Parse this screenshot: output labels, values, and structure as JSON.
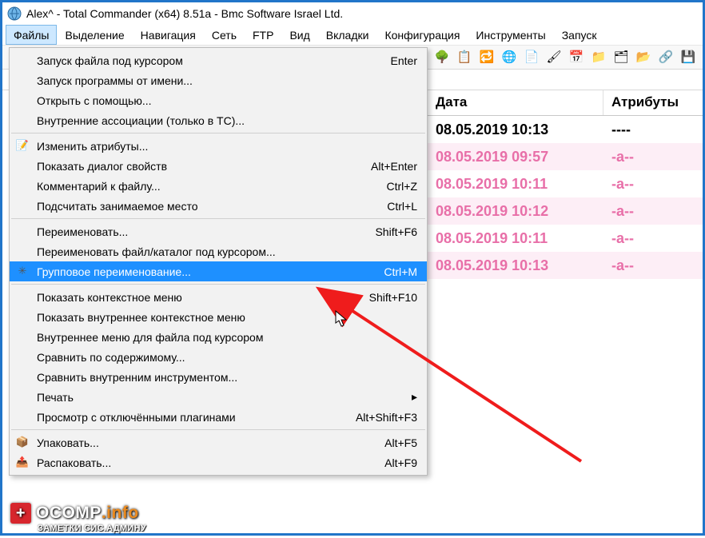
{
  "window": {
    "title": "Alex^ - Total Commander (x64) 8.51a - Bmc Software Israel Ltd."
  },
  "menubar": {
    "items": [
      "Файлы",
      "Выделение",
      "Навигация",
      "Сеть",
      "FTP",
      "Вид",
      "Вкладки",
      "Конфигурация",
      "Инструменты",
      "Запуск"
    ],
    "open_index": 0
  },
  "toolbar_icons": [
    {
      "name": "view-icon",
      "glyph": "🔍"
    },
    {
      "name": "tree-icon",
      "glyph": "🌳"
    },
    {
      "name": "copy-icon",
      "glyph": "📋"
    },
    {
      "name": "sync-icon",
      "glyph": "🔁"
    },
    {
      "name": "ftp-icon",
      "glyph": "🌐"
    },
    {
      "name": "notepad-icon",
      "glyph": "📄"
    },
    {
      "name": "brush-icon",
      "glyph": "🖌"
    },
    {
      "name": "calendar-icon",
      "glyph": "📅"
    },
    {
      "name": "folder-icon",
      "glyph": "📁"
    },
    {
      "name": "folder2-icon",
      "glyph": "🗂"
    },
    {
      "name": "folder3-icon",
      "glyph": "📂"
    },
    {
      "name": "link-icon",
      "glyph": "🔗"
    },
    {
      "name": "disk-icon",
      "glyph": "💾"
    }
  ],
  "dropdown": {
    "groups": [
      [
        {
          "label": "Запуск файла под курсором",
          "shortcut": "Enter"
        },
        {
          "label": "Запуск программы от имени..."
        },
        {
          "label": "Открыть с помощью..."
        },
        {
          "label": "Внутренние ассоциации (только в TC)..."
        }
      ],
      [
        {
          "label": "Изменить атрибуты...",
          "icon": "properties-icon",
          "glyph": "📝"
        },
        {
          "label": "Показать диалог свойств",
          "shortcut": "Alt+Enter"
        },
        {
          "label": "Комментарий к файлу...",
          "shortcut": "Ctrl+Z"
        },
        {
          "label": "Подсчитать занимаемое место",
          "shortcut": "Ctrl+L"
        }
      ],
      [
        {
          "label": "Переименовать...",
          "shortcut": "Shift+F6"
        },
        {
          "label": "Переименовать файл/каталог под курсором..."
        },
        {
          "label": "Групповое переименование...",
          "shortcut": "Ctrl+M",
          "highlight": true,
          "icon": "multi-rename-icon",
          "glyph": "✳"
        }
      ],
      [
        {
          "label": "Показать контекстное меню",
          "shortcut": "Shift+F10"
        },
        {
          "label": "Показать внутреннее контекстное меню"
        },
        {
          "label": "Внутреннее меню для файла под курсором"
        },
        {
          "label": "Сравнить по содержимому..."
        },
        {
          "label": "Сравнить внутренним инструментом..."
        },
        {
          "label": "Печать",
          "submenu": true
        },
        {
          "label": "Просмотр с отключёнными плагинами",
          "shortcut": "Alt+Shift+F3"
        }
      ],
      [
        {
          "label": "Упаковать...",
          "shortcut": "Alt+F5",
          "icon": "pack-icon",
          "glyph": "📦"
        },
        {
          "label": "Распаковать...",
          "shortcut": "Alt+F9",
          "icon": "unpack-icon",
          "glyph": "📤"
        }
      ]
    ]
  },
  "panel": {
    "headers": {
      "date": "Дата",
      "attr": "Атрибуты"
    },
    "rows": [
      {
        "date": "08.05.2019 10:13",
        "attr": "----",
        "parent": true
      },
      {
        "date": "08.05.2019 09:57",
        "attr": "-a--",
        "alt": true
      },
      {
        "date": "08.05.2019 10:11",
        "attr": "-a--"
      },
      {
        "date": "08.05.2019 10:12",
        "attr": "-a--",
        "alt": true
      },
      {
        "date": "08.05.2019 10:11",
        "attr": "-a--"
      },
      {
        "date": "08.05.2019 10:13",
        "attr": "-a--",
        "alt": true
      }
    ]
  },
  "watermark": {
    "brand_main": "OCOMP",
    "brand_suffix": ".info",
    "sub": "ЗАМЕТКИ СИС.АДМИНУ"
  }
}
